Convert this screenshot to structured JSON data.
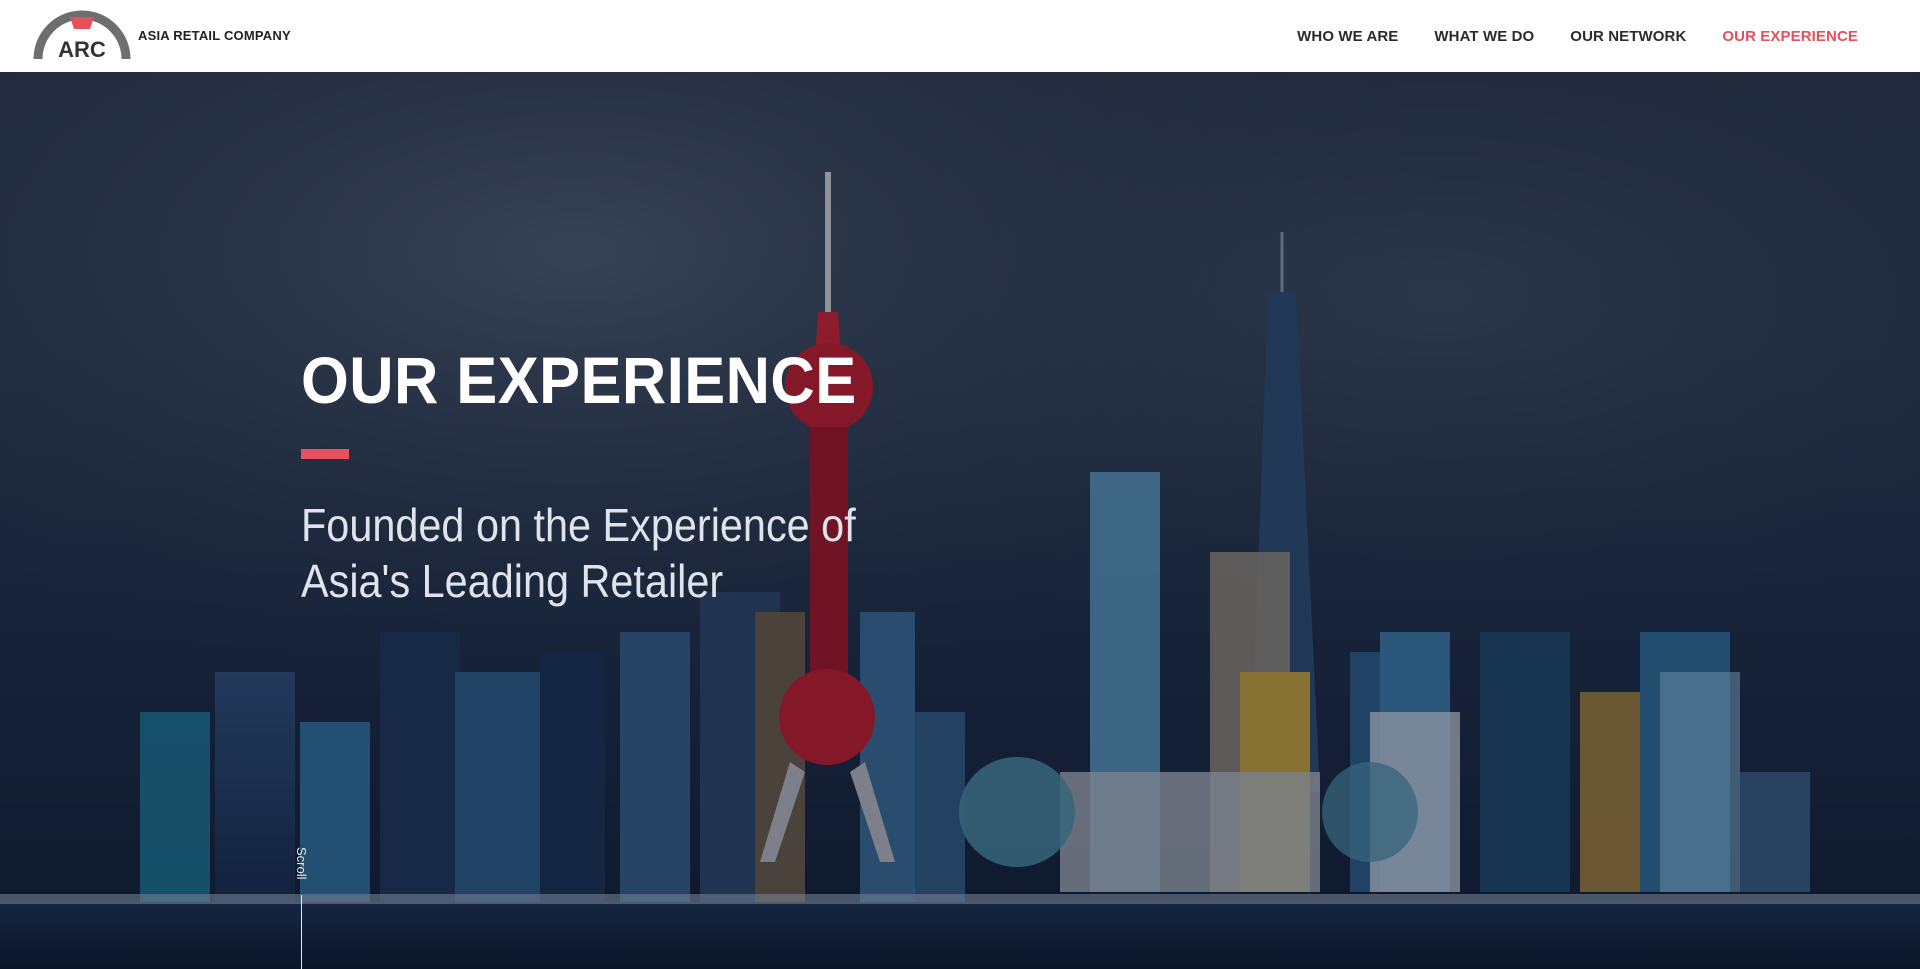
{
  "brand": {
    "logo_text": "ARC",
    "company_name": "ASIA RETAIL COMPANY"
  },
  "nav": {
    "items": [
      {
        "label": "WHO WE ARE",
        "active": false
      },
      {
        "label": "WHAT WE DO",
        "active": false
      },
      {
        "label": "OUR NETWORK",
        "active": false
      },
      {
        "label": "OUR EXPERIENCE",
        "active": true
      }
    ]
  },
  "hero": {
    "title": "OUR EXPERIENCE",
    "subtitle_line1": "Founded on the Experience of",
    "subtitle_line2": "Asia's Leading Retailer",
    "scroll_label": "Scroll"
  },
  "colors": {
    "accent": "#e4505c",
    "header_bg": "#ffffff",
    "nav_text": "#2b2b2b"
  }
}
